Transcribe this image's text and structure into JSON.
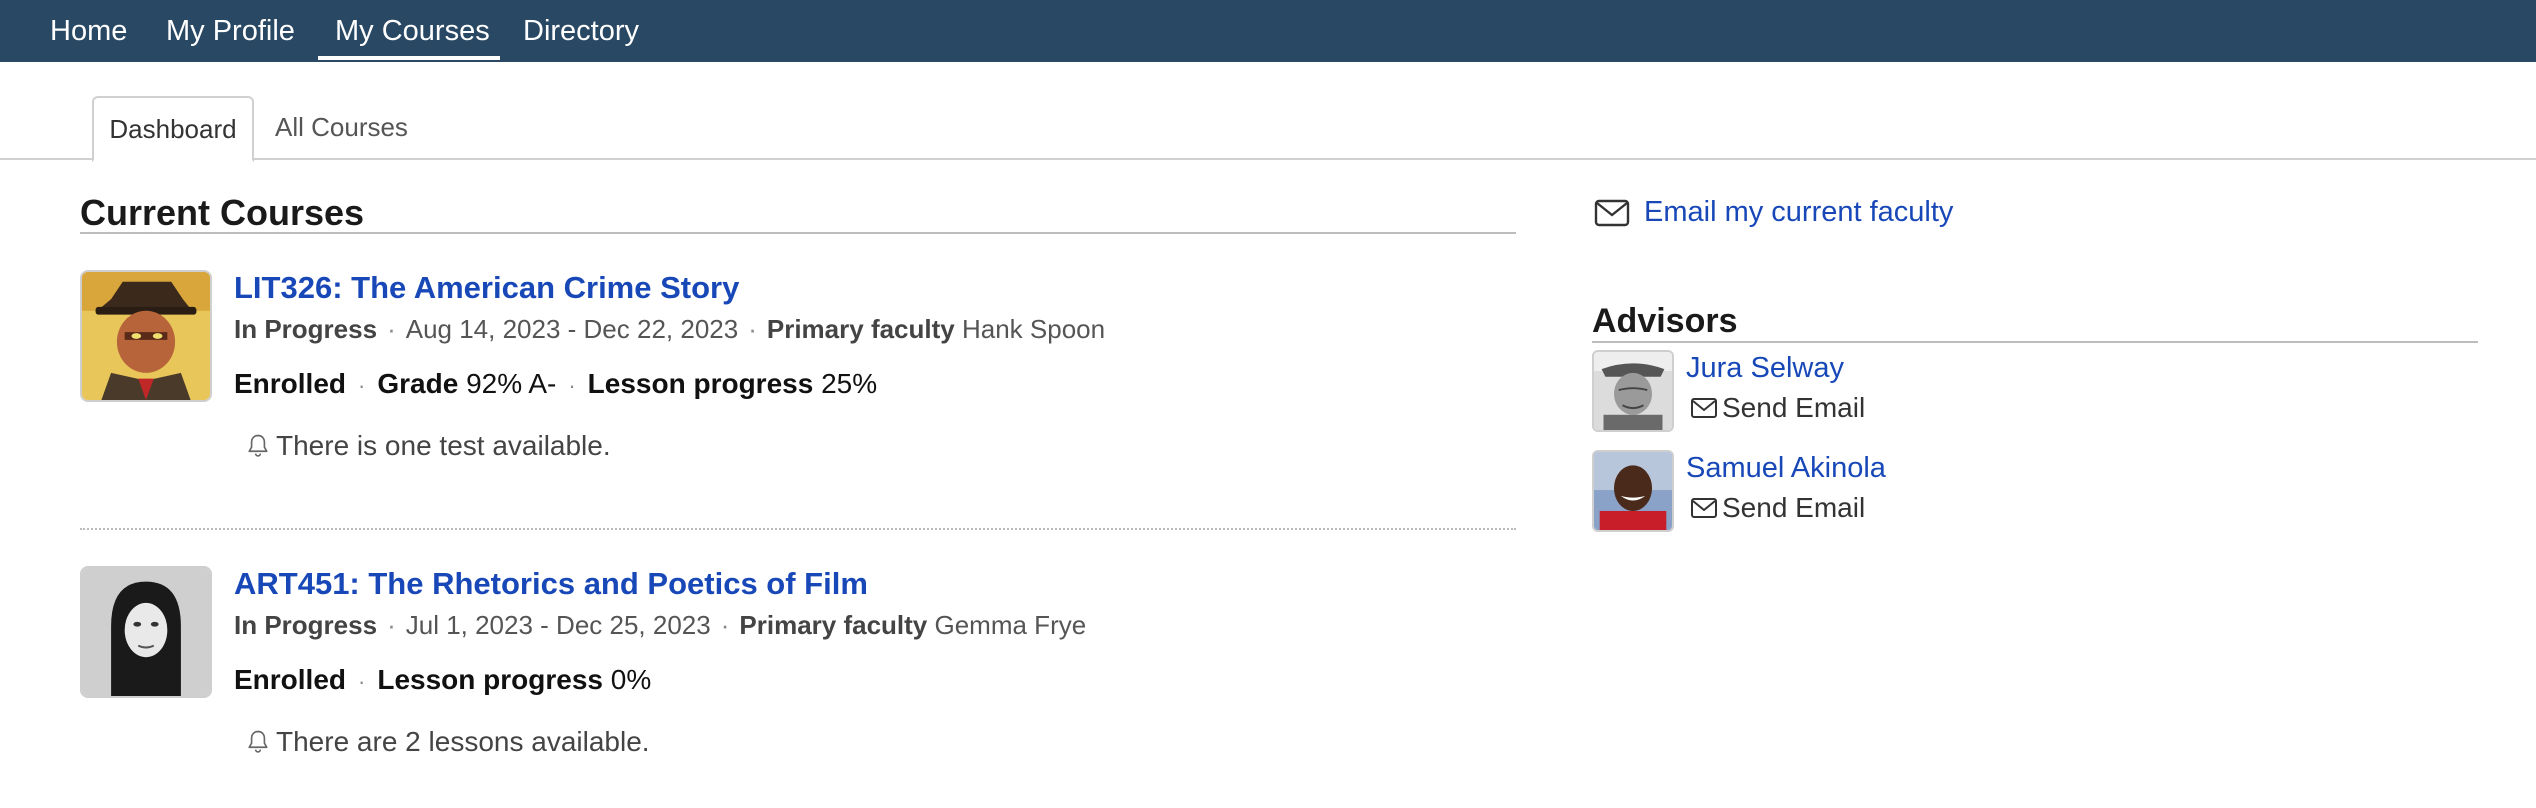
{
  "nav": {
    "items": [
      {
        "label": "Home"
      },
      {
        "label": "My Profile"
      },
      {
        "label": "My Courses"
      },
      {
        "label": "Directory"
      }
    ],
    "active": "My Courses"
  },
  "tabs": {
    "items": [
      {
        "label": "Dashboard"
      },
      {
        "label": "All Courses"
      }
    ],
    "active": "Dashboard"
  },
  "main": {
    "title": "Current Courses",
    "courses": [
      {
        "title": "LIT326: The American Crime Story",
        "status": "In Progress",
        "dates": "Aug 14, 2023 - Dec 22, 2023",
        "faculty_label": "Primary faculty",
        "faculty": "Hank Spoon",
        "enrollment": "Enrolled",
        "grade_label": "Grade",
        "grade": "92% A-",
        "progress_label": "Lesson progress",
        "progress": "25%",
        "notice": "There is one test available."
      },
      {
        "title": "ART451: The Rhetorics and Poetics of Film",
        "status": "In Progress",
        "dates": "Jul 1, 2023 - Dec 25, 2023",
        "faculty_label": "Primary faculty",
        "faculty": "Gemma Frye",
        "enrollment": "Enrolled",
        "progress_label": "Lesson progress",
        "progress": "0%",
        "notice": "There are 2 lessons available."
      }
    ]
  },
  "sidebar": {
    "email_faculty": "Email my current faculty",
    "advisors_title": "Advisors",
    "advisors": [
      {
        "name": "Jura Selway",
        "action": "Send Email"
      },
      {
        "name": "Samuel Akinola",
        "action": "Send Email"
      }
    ]
  },
  "icons": {
    "mail": "mail-icon",
    "bell": "bell-icon"
  },
  "colors": {
    "nav_bg": "#284863",
    "link": "#1848b8"
  }
}
